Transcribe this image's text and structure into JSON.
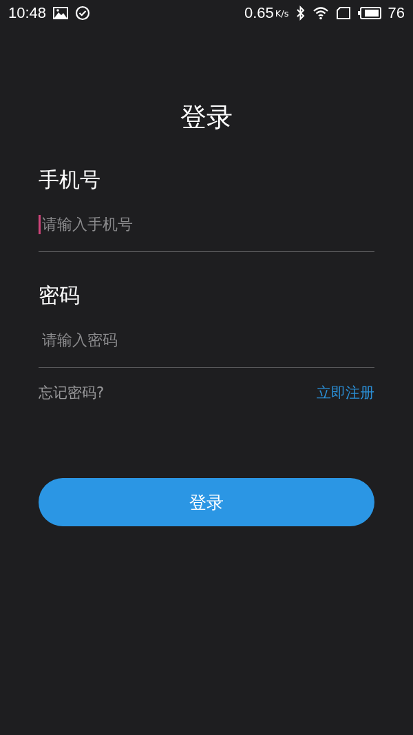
{
  "status_bar": {
    "time": "10:48",
    "speed": "0.65",
    "speed_unit": "K/s",
    "battery": "76"
  },
  "title": "登录",
  "fields": [
    {
      "label": "手机号",
      "placeholder": "请输入手机号",
      "focused": true
    },
    {
      "label": "密码",
      "placeholder": "请输入密码",
      "focused": false
    }
  ],
  "forgot_link": "忘记密码?",
  "register_link": "立即注册",
  "login_button": "登录"
}
